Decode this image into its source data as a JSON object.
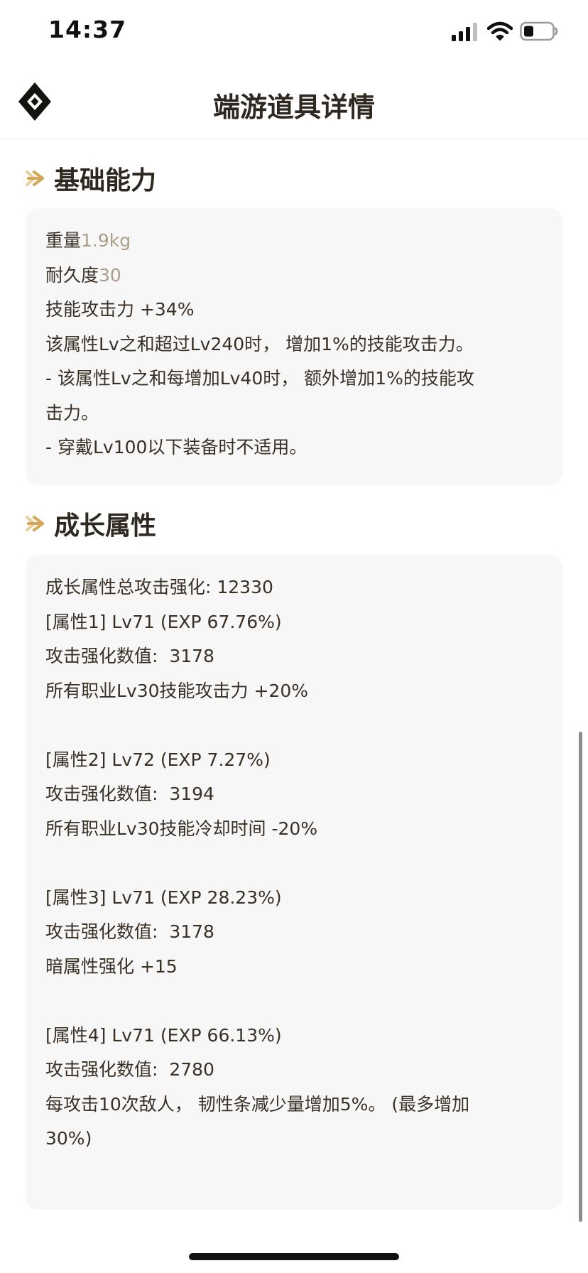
{
  "status": {
    "time": "14:37"
  },
  "header": {
    "title": "端游道具详情"
  },
  "sections": {
    "basic": {
      "title": "基础能力",
      "weight_label": "重量",
      "weight_value": "1.9kg",
      "durability_label": "耐久度",
      "durability_value": "30",
      "lines": [
        "技能攻击力 +34%",
        "该属性Lv之和超过Lv240时， 增加1%的技能攻击力。",
        "- 该属性Lv之和每增加Lv40时， 额外增加1%的技能攻",
        "击力。",
        "- 穿戴Lv100以下装备时不适用。"
      ]
    },
    "growth": {
      "title": "成长属性",
      "total": "成长属性总攻击强化: 12330",
      "attrs": [
        {
          "header": "[属性1] Lv71 (EXP 67.76%)",
          "attack": "攻击强化数值:  3178",
          "effect": "所有职业Lv30技能攻击力 +20%"
        },
        {
          "header": "[属性2] Lv72 (EXP 7.27%)",
          "attack": "攻击强化数值:  3194",
          "effect": "所有职业Lv30技能冷却时间 -20%"
        },
        {
          "header": "[属性3] Lv71 (EXP 28.23%)",
          "attack": "攻击强化数值:  3178",
          "effect": "暗属性强化 +15"
        },
        {
          "header": "[属性4] Lv71 (EXP 66.13%)",
          "attack": "攻击强化数值:  2780",
          "effect": "每攻击10次敌人， 韧性条减少量增加5%。 (最多增加",
          "effect_cont": "30%)"
        }
      ]
    }
  },
  "colors": {
    "accent_gold": "#d4a656",
    "muted_text": "#ab9d88",
    "card_bg": "#f7f7f7"
  },
  "icons": {
    "logo": "diamond-logo-icon",
    "section_marker": "double-chevron-right-icon",
    "signal": "signal-icon",
    "wifi": "wifi-icon",
    "battery": "battery-icon"
  }
}
